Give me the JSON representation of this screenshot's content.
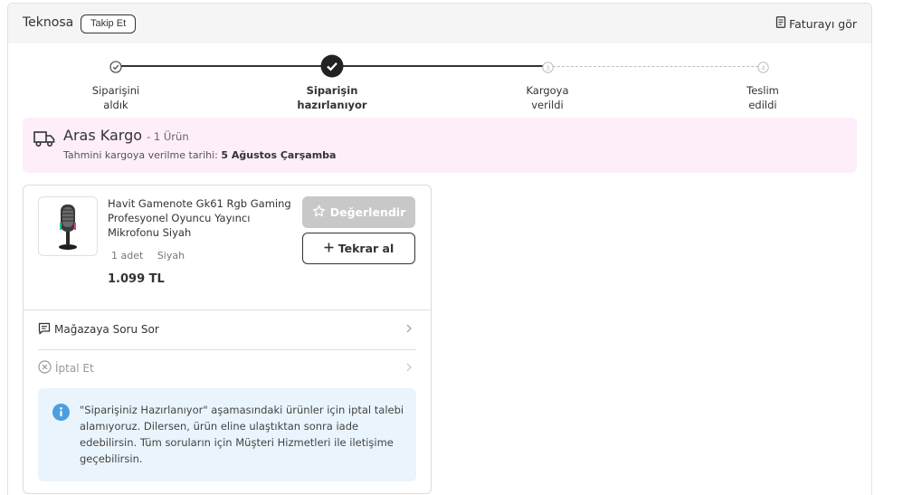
{
  "header": {
    "seller_name": "Teknosa",
    "follow_label": "Takip Et",
    "invoice_label": "Faturayı gör"
  },
  "stepper": {
    "steps": [
      {
        "label_line1": "Siparişini",
        "label_line2": "aldık",
        "state": "done"
      },
      {
        "label_line1": "Siparişin",
        "label_line2": "hazırlanıyor",
        "state": "current"
      },
      {
        "label_line1": "Kargoya",
        "label_line2": "verildi",
        "state": "pending",
        "number": "3"
      },
      {
        "label_line1": "Teslim",
        "label_line2": "edildi",
        "state": "pending",
        "number": "4"
      }
    ]
  },
  "cargo": {
    "company": "Aras Kargo",
    "count": "- 1 Ürün",
    "date_label": "Tahmini kargoya verilme tarihi:",
    "date_value": "5 Ağustos Çarşamba"
  },
  "product": {
    "name": "Havit Gamenote Gk61 Rgb Gaming Profesyonel Oyuncu Yayıncı Mikrofonu Siyah",
    "quantity": "1 adet",
    "color": "Siyah",
    "price": "1.099 TL",
    "rate_label": "Değerlendir",
    "rebuy_label": "Tekrar al"
  },
  "actions": {
    "ask_store_label": "Mağazaya Soru Sor",
    "cancel_label": "İptal Et"
  },
  "info": {
    "text": "\"Siparişiniz Hazırlanıyor\" aşamasındaki ürünler için iptal talebi alamıyoruz. Dilersen, ürün eline ulaştıktan sonra iade edebilirsin. Tüm soruların için Müşteri Hizmetleri ile iletişime geçebilirsin."
  },
  "colors": {
    "cargo_bg": "#fdeefa",
    "info_bg": "#eaf4fc",
    "info_icon": "#4a9fe0",
    "disabled_button": "#c8c8c8",
    "text_dark": "#333333"
  },
  "icons": {
    "invoice": "document-icon",
    "truck": "truck-icon",
    "star": "star-icon",
    "plus": "plus-icon",
    "chat": "chat-icon",
    "cancel": "x-circle-icon",
    "info": "info-icon",
    "chevron": "chevron-right-icon"
  }
}
